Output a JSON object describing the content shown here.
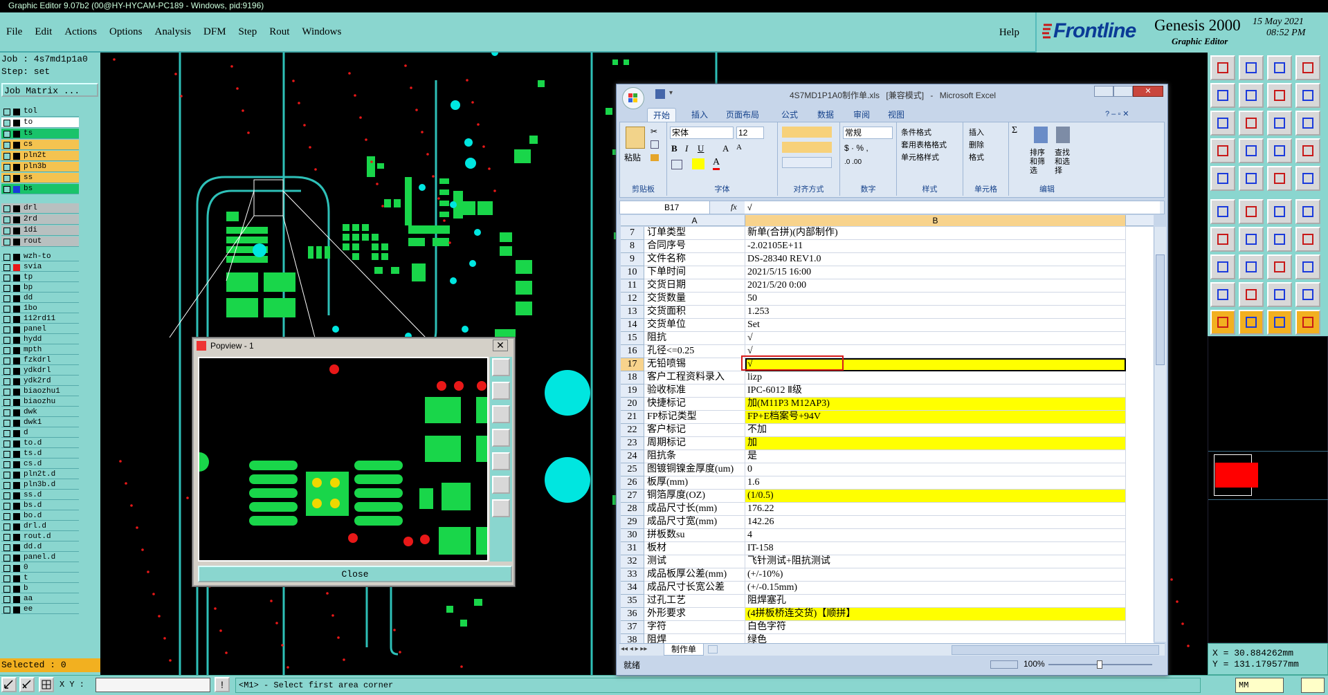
{
  "window_title": "Graphic Editor 9.07b2 (00@HY-HYCAM-PC189 - Windows, pid:9196)",
  "menu": [
    "File",
    "Edit",
    "Actions",
    "Options",
    "Analysis",
    "DFM",
    "Step",
    "Rout",
    "Windows"
  ],
  "help_label": "Help",
  "brand": {
    "logo": "Frontline",
    "product": "Genesis 2000",
    "subtitle": "Graphic Editor",
    "date": "15 May 2021",
    "time": "08:52 PM"
  },
  "job": {
    "job_label": "Job : 4s7md1p1a0",
    "step_label": "Step: set",
    "matrix_button": "Job Matrix ..."
  },
  "layers_group1": [
    {
      "name": "tol",
      "color": "#8ad6cf"
    },
    {
      "name": "to",
      "color": "#ffffff"
    },
    {
      "name": "ts",
      "color": "#19c36a"
    },
    {
      "name": "cs",
      "color": "#f4c350"
    },
    {
      "name": "pln2t",
      "color": "#f4c350"
    },
    {
      "name": "pln3b",
      "color": "#f4c350"
    },
    {
      "name": "ss",
      "color": "#f4c350"
    },
    {
      "name": "bs",
      "color": "#19c36a"
    }
  ],
  "layers_group2": [
    {
      "name": "drl",
      "color": "#b8c0c0"
    },
    {
      "name": "2rd",
      "color": "#b8c0c0"
    },
    {
      "name": "1di",
      "color": "#b8c0c0"
    },
    {
      "name": "rout",
      "color": "#b8c0c0"
    }
  ],
  "layers_group3": [
    "wzh-to",
    "svia",
    "tp",
    "bp",
    "dd",
    "1bo",
    "112rd11",
    "panel",
    "hydd",
    "mpth",
    "fzkdrl",
    "ydkdrl",
    "ydk2rd",
    "biaozhu1",
    "biaozhu",
    "dwk",
    "dwk1",
    "d",
    "to.d",
    "ts.d",
    "cs.d",
    "pln2t.d",
    "pln3b.d",
    "ss.d",
    "bs.d",
    "bo.d",
    "drl.d",
    "rout.d",
    "dd.d",
    "panel.d",
    "0",
    "t",
    "b",
    "aa",
    "ee"
  ],
  "selected_label": "Selected : 0",
  "xy_label": "X Y :",
  "status_prompt": "<M1> - Select first area corner",
  "units_label": "MM",
  "coords": {
    "x": "X  =   30.884262mm",
    "y": "Y  =  131.179577mm"
  },
  "popview": {
    "title": "Popview - 1",
    "close_label": "Close"
  },
  "excel": {
    "title_file": "4S7MD1P1A0制作单.xls",
    "title_mode": "[兼容模式]",
    "title_app": "Microsoft Excel",
    "tabs": [
      "开始",
      "插入",
      "页面布局",
      "公式",
      "数据",
      "审阅",
      "视图"
    ],
    "font_name": "宋体",
    "font_size": "12",
    "number_format": "常规",
    "styles": [
      "条件格式",
      "套用表格格式",
      "单元格样式"
    ],
    "cells_cmds": [
      "插入",
      "删除",
      "格式"
    ],
    "edit_cmds": [
      "排序和筛选",
      "查找和选择"
    ],
    "paste_label": "粘贴",
    "groups": [
      "剪贴板",
      "字体",
      "对齐方式",
      "数字",
      "样式",
      "单元格",
      "编辑"
    ],
    "name_box": "B17",
    "formula_value": "√",
    "col_a": "A",
    "col_b": "B",
    "sheet_tab": "制作单",
    "status_ready": "就绪",
    "zoom": "100%",
    "rows": [
      {
        "n": "7",
        "a": "订单类型",
        "b": "新单(合拼)(内部制作)",
        "y": false
      },
      {
        "n": "8",
        "a": "合同序号",
        "b": "-2.02105E+11",
        "y": false
      },
      {
        "n": "9",
        "a": "文件名称",
        "b": "DS-28340 REV1.0",
        "y": false
      },
      {
        "n": "10",
        "a": "下单时间",
        "b": "2021/5/15 16:00",
        "y": false
      },
      {
        "n": "11",
        "a": "交货日期",
        "b": "2021/5/20 0:00",
        "y": false
      },
      {
        "n": "12",
        "a": "交货数量",
        "b": "50",
        "y": false
      },
      {
        "n": "13",
        "a": "交货面积",
        "b": "1.253",
        "y": false
      },
      {
        "n": "14",
        "a": "交货单位",
        "b": "Set",
        "y": false
      },
      {
        "n": "15",
        "a": "阻抗",
        "b": "√",
        "y": false
      },
      {
        "n": "16",
        "a": "孔径<=0.25",
        "b": "√",
        "y": false
      },
      {
        "n": "17",
        "a": "无铅喷锡",
        "b": "√",
        "y": true
      },
      {
        "n": "18",
        "a": "客户工程资料录入",
        "b": "lizp",
        "y": false
      },
      {
        "n": "19",
        "a": "验收标准",
        "b": "IPC-6012 Ⅱ级",
        "y": false
      },
      {
        "n": "20",
        "a": "快捷标记",
        "b": "加(M11P3 M12AP3)",
        "y": true
      },
      {
        "n": "21",
        "a": "FP标记类型",
        "b": "FP+E档案号+94V",
        "y": true
      },
      {
        "n": "22",
        "a": "客户标记",
        "b": "不加",
        "y": false
      },
      {
        "n": "23",
        "a": "周期标记",
        "b": "加",
        "y": true
      },
      {
        "n": "24",
        "a": "阻抗条",
        "b": "是",
        "y": false
      },
      {
        "n": "25",
        "a": "图镀铜镍金厚度(um)",
        "b": "0",
        "y": false
      },
      {
        "n": "26",
        "a": "板厚(mm)",
        "b": "1.6",
        "y": false
      },
      {
        "n": "27",
        "a": "铜箔厚度(OZ)",
        "b": "(1/0.5)",
        "y": true
      },
      {
        "n": "28",
        "a": "成品尺寸长(mm)",
        "b": "176.22",
        "y": false
      },
      {
        "n": "29",
        "a": "成品尺寸宽(mm)",
        "b": "142.26",
        "y": false
      },
      {
        "n": "30",
        "a": "拼板数su",
        "b": "4",
        "y": false
      },
      {
        "n": "31",
        "a": "板材",
        "b": "IT-158",
        "y": false
      },
      {
        "n": "32",
        "a": "测试",
        "b": "飞针测试+阻抗测试",
        "y": false
      },
      {
        "n": "33",
        "a": "成品板厚公差(mm)",
        "b": "(+/-10%)",
        "y": false
      },
      {
        "n": "34",
        "a": "成品尺寸长宽公差",
        "b": "(+/-0.15mm)",
        "y": false
      },
      {
        "n": "35",
        "a": "过孔工艺",
        "b": "阻焊塞孔",
        "y": false
      },
      {
        "n": "36",
        "a": "外形要求",
        "b": "(4拼板桥连交货)【顺拼】",
        "y": true
      },
      {
        "n": "37",
        "a": "字符",
        "b": "白色字符",
        "y": false
      },
      {
        "n": "38",
        "a": "阻焊",
        "b": "绿色",
        "y": false
      }
    ]
  }
}
